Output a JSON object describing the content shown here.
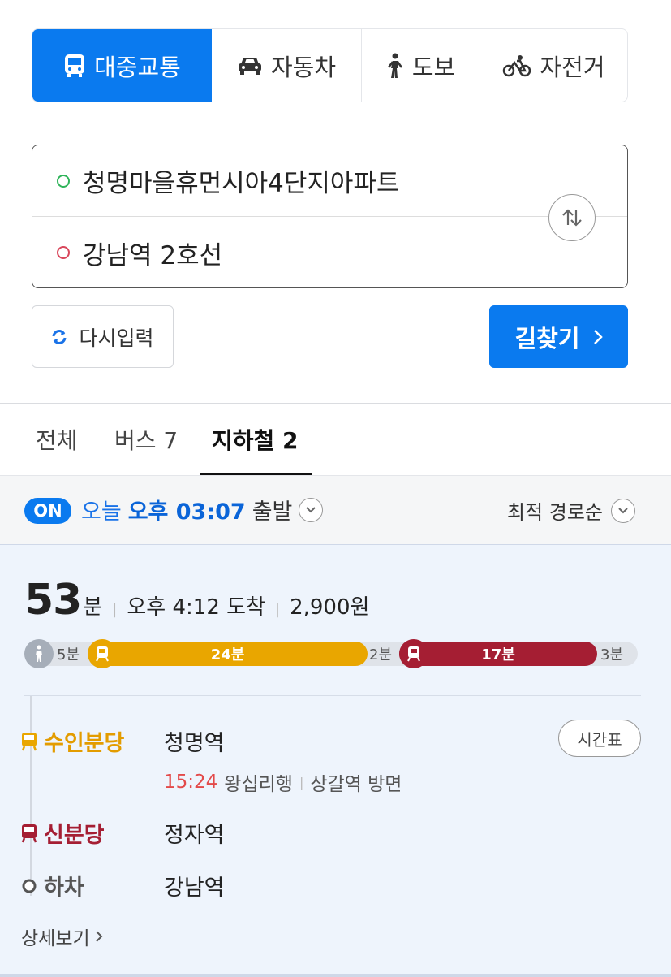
{
  "mode_tabs": [
    {
      "label": "대중교통",
      "icon": "bus-icon",
      "active": true
    },
    {
      "label": "자동차",
      "icon": "car-icon",
      "active": false
    },
    {
      "label": "도보",
      "icon": "walk-icon",
      "active": false
    },
    {
      "label": "자전거",
      "icon": "bicycle-icon",
      "active": false
    }
  ],
  "route": {
    "origin": "청명마을휴먼시아4단지아파트",
    "destination": "강남역 2호선"
  },
  "actions": {
    "reset_label": "다시입력",
    "search_label": "길찾기"
  },
  "result_tabs": [
    {
      "label": "전체",
      "active": false
    },
    {
      "label": "버스 7",
      "active": true,
      "display": "버스 7"
    },
    {
      "label": "지하철 2",
      "active": true
    }
  ],
  "departure": {
    "badge": "ON",
    "day": "오늘",
    "time": "오후 03:07",
    "suffix": "출발",
    "sort": "최적 경로순"
  },
  "summary": {
    "minutes": "53",
    "minutes_unit": "분",
    "arrival": "오후 4:12 도착",
    "fare": "2,900원"
  },
  "timeline": {
    "walk_start": "5분",
    "seg1": "24분",
    "transfer": "2분",
    "seg2": "17분",
    "walk_end": "3분"
  },
  "steps": [
    {
      "line": "수인분당",
      "station": "청명역",
      "color": "#e39c00"
    },
    {
      "line": "신분당",
      "station": "정자역",
      "color": "#a51e33"
    },
    {
      "line": "하차",
      "station": "강남역",
      "color": "#555555"
    }
  ],
  "train": {
    "time": "15:24",
    "bound": "왕십리행",
    "direction": "상갈역 방면"
  },
  "timetable_label": "시간표",
  "detail_label": "상세보기",
  "colors": {
    "accent": "#0a7aef",
    "suin_bundang": "#e9a600",
    "shin_bundang": "#a51e33"
  }
}
